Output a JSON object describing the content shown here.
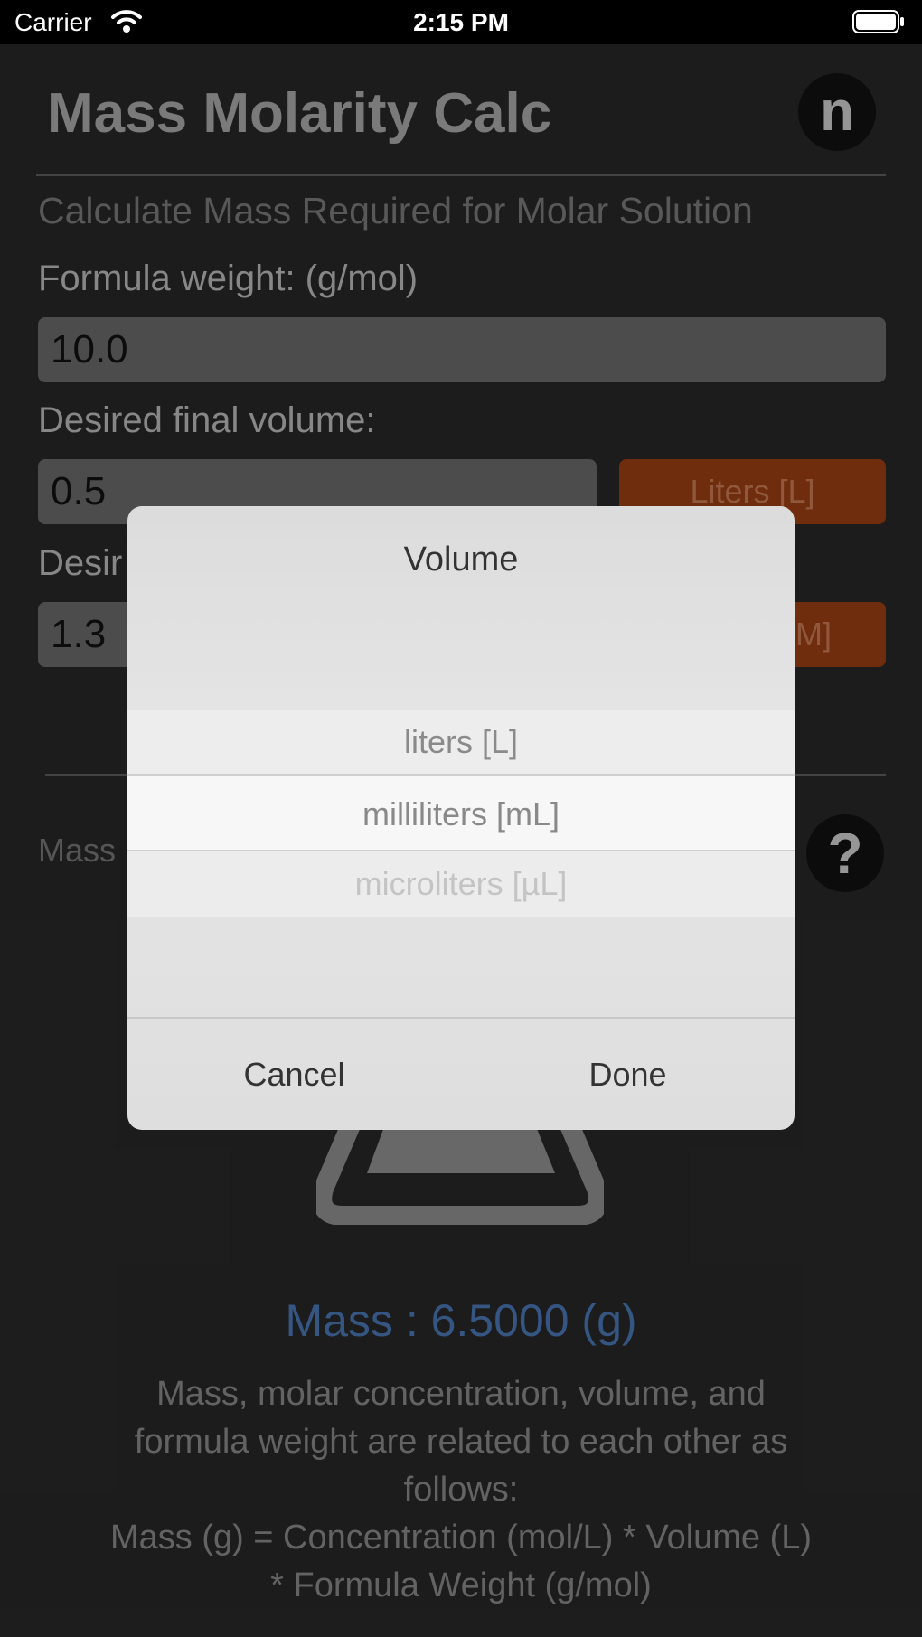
{
  "status": {
    "carrier": "Carrier",
    "time": "2:15 PM"
  },
  "header": {
    "title": "Mass Molarity Calc",
    "logo_letter": "n"
  },
  "subtitle": "Calculate Mass Required for Molar Solution",
  "formula_weight": {
    "label": "Formula weight:  (g/mol)",
    "value": "10.0"
  },
  "volume": {
    "label": "Desired final volume:",
    "value": "0.5",
    "unit_button": "Liters [L]"
  },
  "concentration": {
    "label_visible": "Desir",
    "value": "1.3",
    "unit_button_visible": "M]"
  },
  "mass_label_visible": "Mass",
  "result": "Mass : 6.5000 (g)",
  "explanation": [
    "Mass, molar concentration, volume, and",
    "formula weight are related to each other as",
    "follows:",
    "Mass (g) = Concentration (mol/L) * Volume (L)",
    "* Formula Weight (g/mol)"
  ],
  "picker_dialog": {
    "title": "Volume",
    "options": [
      "liters [L]",
      "milliliters [mL]",
      "microliters [µL]"
    ],
    "selected": "milliliters [mL]",
    "cancel": "Cancel",
    "done": "Done"
  },
  "colors": {
    "background": "#282828",
    "accent_button": "#9a3f12",
    "result_text": "#4a78b4"
  },
  "icons": [
    "wifi-icon",
    "battery-icon",
    "logo-icon",
    "help-icon",
    "flask-icon"
  ]
}
